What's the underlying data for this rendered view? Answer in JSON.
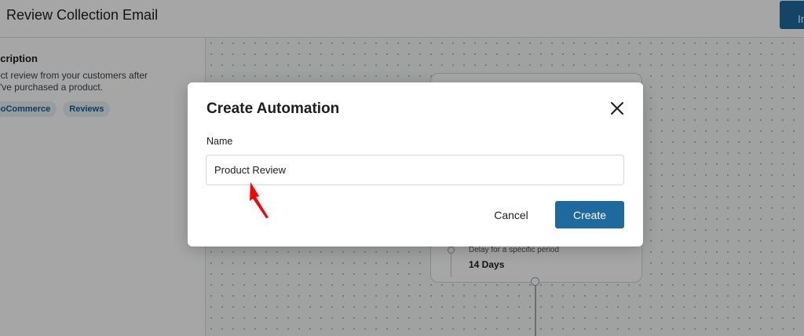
{
  "header": {
    "title": "Review Collection Email",
    "import_label": "Im"
  },
  "sidebar": {
    "heading": "scription",
    "description": "ect review from your customers after y've purchased a product.",
    "tags": [
      "ooCommerce",
      "Reviews"
    ]
  },
  "workflow": {
    "delay_label": "Delay for a specific period",
    "delay_value": "14 Days"
  },
  "modal": {
    "title": "Create Automation",
    "name_label": "Name",
    "name_value": "Product Review",
    "cancel_label": "Cancel",
    "create_label": "Create"
  },
  "colors": {
    "primary": "#1e6a9e",
    "annotation": "#ff0000"
  },
  "icons": [
    "close-icon",
    "annotation-arrow-icon"
  ]
}
